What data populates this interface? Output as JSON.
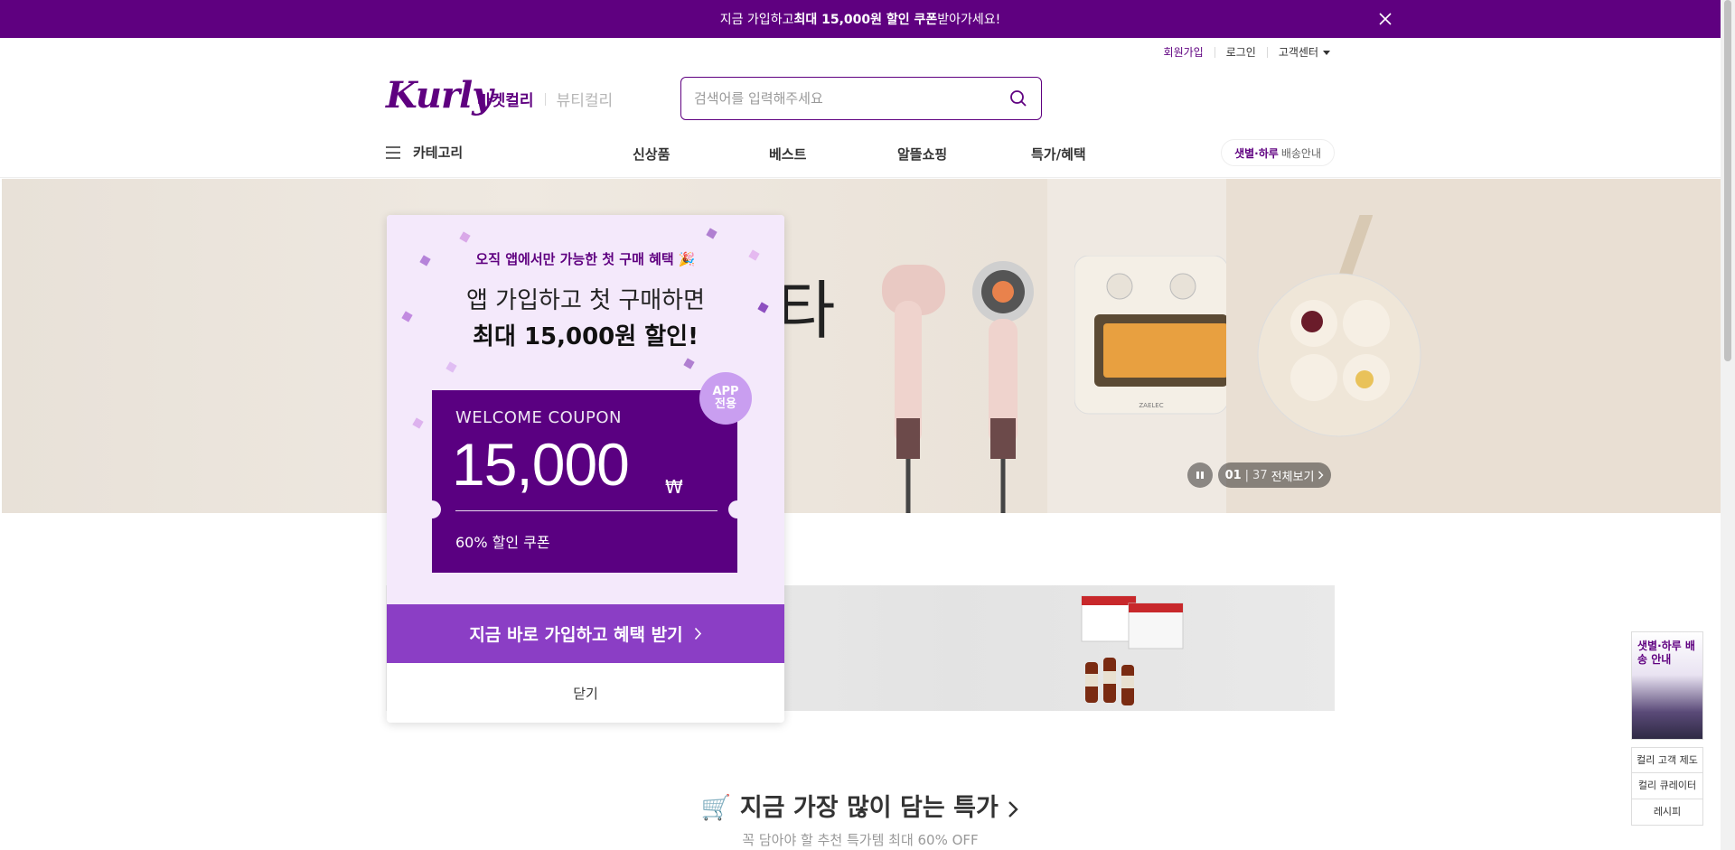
{
  "top_banner": {
    "text_prefix": "지금 가입하고 ",
    "text_bold": "최대 15,000원 할인 쿠폰",
    "text_suffix": " 받아가세요!"
  },
  "user_menu": {
    "signup": "회원가입",
    "login": "로그인",
    "customer_center": "고객센터"
  },
  "header": {
    "logo": "Kurly",
    "tab_market": "마켓컬리",
    "tab_beauty": "뷰티컬리",
    "search_placeholder": "검색어를 입력해주세요"
  },
  "gnb": {
    "category": "카테고리",
    "menu": [
      "신상품",
      "베스트",
      "알뜰쇼핑",
      "특가/혜택"
    ],
    "delivery_bold": "샛별·하루",
    "delivery_rest": "배송안내"
  },
  "main_banner": {
    "big_text": "타",
    "current": "01",
    "separator": "|",
    "total": "37",
    "view_all": "전체보기"
  },
  "section": {
    "title": "지금 가장 많이 담는 특가",
    "subtitle": "꼭 담아야 할 추천 특가템 최대 60% OFF"
  },
  "side_nav": {
    "ad_text": "샛별·하루 배송 안내",
    "links": [
      "컬리 고객 제도",
      "컬리 큐레이터",
      "레시피"
    ]
  },
  "popup": {
    "eyebrow": "오직 앱에서만 가능한 첫 구매 혜택 🎉",
    "headline1": "앱 가입하고 첫 구매하면",
    "headline2": "최대 15,000원 할인!",
    "badge_line1": "APP",
    "badge_line2": "전용",
    "coupon_title": "WELCOME COUPON",
    "coupon_amount": "15,000",
    "coupon_unit": "₩",
    "coupon_desc": "60% 할인 쿠폰",
    "cta": "지금 바로 가입하고 혜택 받기",
    "close": "닫기"
  },
  "colors": {
    "brand": "#5f0080",
    "cta": "#8b3ec5",
    "coupon": "#5a0081",
    "popup_bg": "#f4e9fb"
  }
}
